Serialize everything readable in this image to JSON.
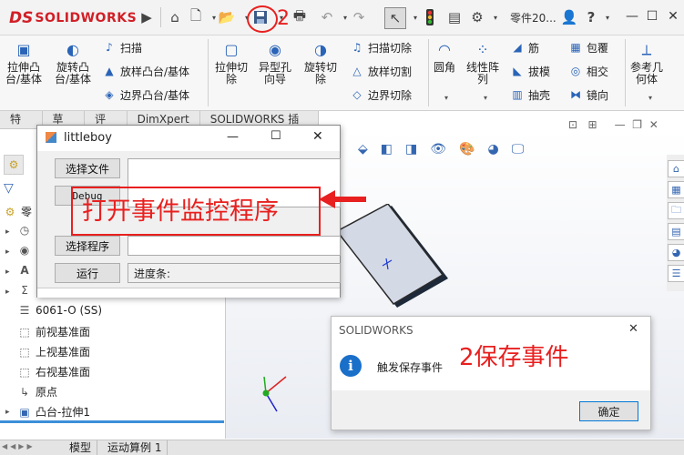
{
  "brand": {
    "logo_ds": "DS",
    "logo_name": "SOLIDWORKS"
  },
  "titlebar": {
    "doc_name": "零件20...",
    "help": "?"
  },
  "step_marker": "2",
  "ribbon": {
    "extrude_boss": "拉伸凸\n台/基体",
    "revolve_boss": "旋转凸\n台/基体",
    "sweep": "扫描",
    "loft_boss": "放样凸台/基体",
    "boundary_boss": "边界凸台/基体",
    "extrude_cut": "拉伸切\n除",
    "hole_wizard": "异型孔\n向导",
    "revolve_cut": "旋转切\n除",
    "sweep_cut": "扫描切除",
    "loft_cut": "放样切割",
    "boundary_cut": "边界切除",
    "fillet": "圆角",
    "linear_pattern": "线性阵\n列",
    "rib": "筋",
    "draft": "拔模",
    "shell": "抽壳",
    "wrap": "包覆",
    "intersect": "相交",
    "mirror": "镜向",
    "ref_geometry": "参考几\n何体"
  },
  "tabs": [
    "特征",
    "草图",
    "评估",
    "DimXpert",
    "SOLIDWORKS 插件"
  ],
  "tree": {
    "root": "零",
    "material": "6061-O (SS)",
    "front_plane": "前视基准面",
    "top_plane": "上视基准面",
    "right_plane": "右视基准面",
    "origin": "原点",
    "extrude1": "凸台-拉伸1"
  },
  "bottom_tabs": [
    "模型",
    "运动算例 1"
  ],
  "littleboy": {
    "title": "littleboy",
    "select_file": "选择文件",
    "debug": "Debug",
    "select_program": "选择程序",
    "run": "运行",
    "progress_label": "进度条:"
  },
  "annotations": {
    "main": "打开事件监控程序",
    "save_event": "2保存事件"
  },
  "msgbox": {
    "title": "SOLIDWORKS",
    "message": "触发保存事件",
    "ok": "确定"
  },
  "colors": {
    "brand_red": "#d11f26",
    "annotation_red": "#e8201f",
    "accent_blue": "#0078d7"
  }
}
